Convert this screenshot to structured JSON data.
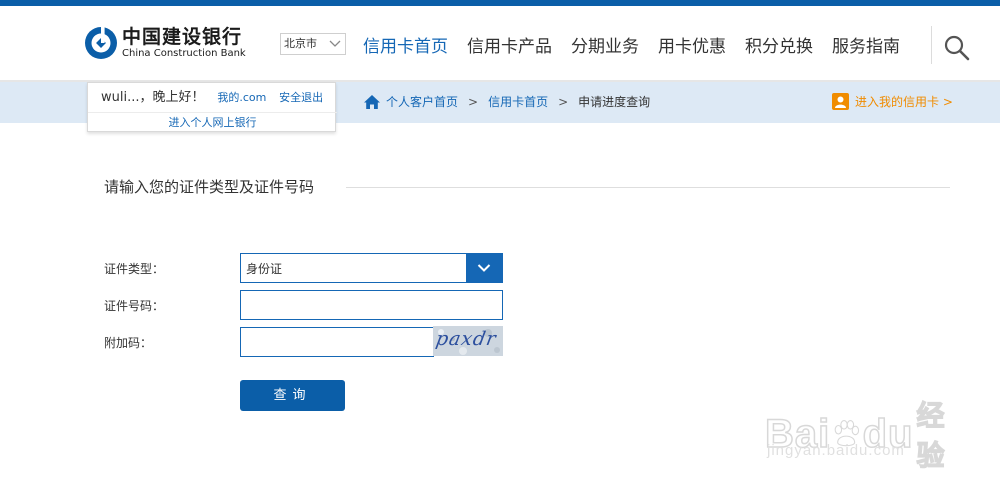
{
  "header": {
    "logo_cn": "中国建设银行",
    "logo_en": "China Construction Bank",
    "city": "北京市",
    "nav": [
      "信用卡首页",
      "信用卡产品",
      "分期业务",
      "用卡优惠",
      "积分兑换",
      "服务指南"
    ],
    "active_nav_index": 0
  },
  "user_panel": {
    "greeting": "wuli...，晚上好！",
    "my_link": "我的.com",
    "logout": "安全退出",
    "online_banking": "进入个人网上银行"
  },
  "breadcrumb": {
    "items": [
      "个人客户首页",
      "信用卡首页"
    ],
    "separator": ">",
    "current": "申请进度查询"
  },
  "my_card_link": "进入我的信用卡 >",
  "form": {
    "section_title": "请输入您的证件类型及证件号码",
    "id_type_label": "证件类型：",
    "id_type_value": "身份证",
    "id_number_label": "证件号码：",
    "id_number_value": "",
    "captcha_label": "附加码：",
    "captcha_value": "",
    "captcha_text": "paxdr",
    "submit_label": "查询"
  },
  "watermark": {
    "brand": "Bai",
    "brand_suffix": "du",
    "suffix_cn": "经验",
    "url": "jingyan.baidu.com"
  },
  "colors": {
    "brand_blue": "#0b5ea8",
    "link_blue": "#1567b5",
    "band_blue": "#dde9f5",
    "orange": "#f08c00"
  }
}
